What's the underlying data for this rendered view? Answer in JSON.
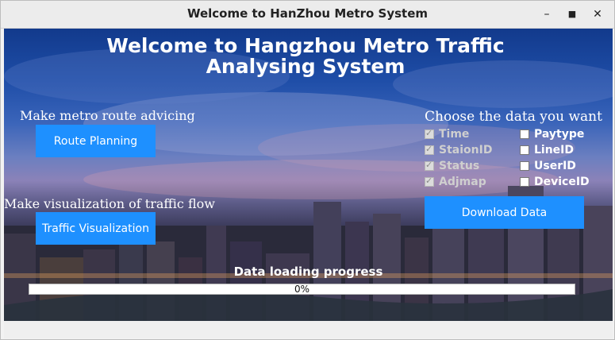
{
  "window": {
    "title": "Welcome to HanZhou Metro System",
    "minimize_glyph": "–",
    "maximize_glyph": "■",
    "close_glyph": "✕"
  },
  "header": {
    "line1": "Welcome to Hangzhou Metro Traffic",
    "line2": "Analysing System"
  },
  "route": {
    "label": "Make metro route advicing",
    "button": "Route Planning"
  },
  "visualization": {
    "label": "Make visualization of traffic flow",
    "button": "Traffic Visualization"
  },
  "data_selection": {
    "label": "Choose the data you want",
    "options": [
      {
        "label": "Time",
        "checked": true
      },
      {
        "label": "StaionID",
        "checked": true
      },
      {
        "label": "Status",
        "checked": true
      },
      {
        "label": "Adjmap",
        "checked": true
      },
      {
        "label": "Paytype",
        "checked": false
      },
      {
        "label": "LineID",
        "checked": false
      },
      {
        "label": "UserID",
        "checked": false
      },
      {
        "label": "DeviceID",
        "checked": false
      }
    ],
    "download_button": "Download Data"
  },
  "progress": {
    "label": "Data loading progress",
    "value": 0,
    "text": "0%"
  },
  "colors": {
    "button": "#1e90ff",
    "title_text": "#ffffff"
  },
  "background_image": "hangzhou-city-night-skyline"
}
